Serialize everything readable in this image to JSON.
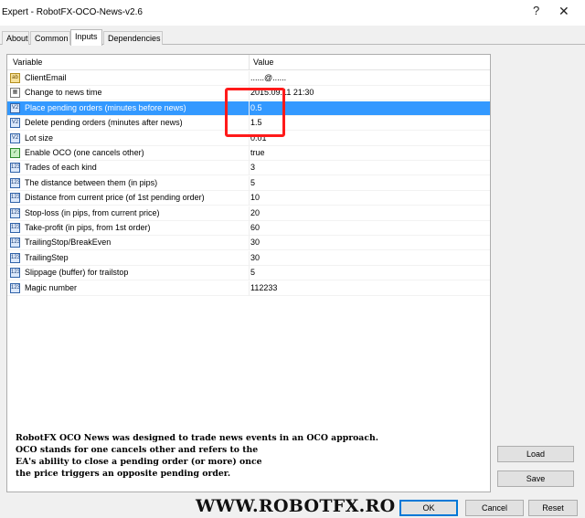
{
  "window": {
    "title": "Expert - RobotFX-OCO-News-v2.6",
    "help_glyph": "?",
    "close_glyph": "✕"
  },
  "tabs": [
    {
      "label": "About",
      "active": false
    },
    {
      "label": "Common",
      "active": false
    },
    {
      "label": "Inputs",
      "active": true
    },
    {
      "label": "Dependencies",
      "active": false
    }
  ],
  "grid": {
    "headers": {
      "variable": "Variable",
      "value": "Value"
    },
    "rows": [
      {
        "icon": "string-icon",
        "glyph": "ab",
        "name": "ClientEmail",
        "value": "......@......",
        "selected": false
      },
      {
        "icon": "datetime-icon",
        "glyph": "▦",
        "name": "Change to news time",
        "value": "2015.09.11 21:30",
        "selected": false
      },
      {
        "icon": "double-icon",
        "glyph": "V2",
        "name": "Place pending orders (minutes before news)",
        "value": "0.5",
        "selected": true
      },
      {
        "icon": "double-icon",
        "glyph": "V2",
        "name": "Delete pending orders (minutes after news)",
        "value": "1.5",
        "selected": false
      },
      {
        "icon": "double-icon",
        "glyph": "V2",
        "name": "Lot size",
        "value": "0.01",
        "selected": false
      },
      {
        "icon": "bool-icon",
        "glyph": "✓",
        "name": "Enable OCO (one cancels other)",
        "value": "true",
        "selected": false
      },
      {
        "icon": "int-icon",
        "glyph": "123",
        "name": "Trades of each kind",
        "value": "3",
        "selected": false
      },
      {
        "icon": "int-icon",
        "glyph": "123",
        "name": "The distance between them (in pips)",
        "value": "5",
        "selected": false
      },
      {
        "icon": "int-icon",
        "glyph": "123",
        "name": "Distance from current price (of 1st pending order)",
        "value": "10",
        "selected": false
      },
      {
        "icon": "int-icon",
        "glyph": "123",
        "name": "Stop-loss (in pips, from current price)",
        "value": "20",
        "selected": false
      },
      {
        "icon": "int-icon",
        "glyph": "123",
        "name": "Take-profit (in pips, from 1st order)",
        "value": "60",
        "selected": false
      },
      {
        "icon": "int-icon",
        "glyph": "123",
        "name": "TrailingStop/BreakEven",
        "value": "30",
        "selected": false
      },
      {
        "icon": "int-icon",
        "glyph": "123",
        "name": "TrailingStep",
        "value": "30",
        "selected": false
      },
      {
        "icon": "int-icon",
        "glyph": "123",
        "name": "Slippage (buffer) for trailstop",
        "value": "5",
        "selected": false
      },
      {
        "icon": "int-icon",
        "glyph": "123",
        "name": "Magic number",
        "value": "112233",
        "selected": false
      }
    ]
  },
  "promo_lines": [
    "RobotFX OCO News was designed to trade news events in an OCO approach.",
    "OCO stands for one cancels other and refers to the",
    "EA's ability to close a pending order (or more) once",
    "the price triggers an opposite pending order."
  ],
  "buttons": {
    "load": "Load",
    "save": "Save",
    "ok": "OK",
    "cancel": "Cancel",
    "reset": "Reset"
  },
  "watermark": "WWW.ROBOTFX.RO",
  "colors": {
    "selection": "#3399ff",
    "highlight_box": "#ff1a1a"
  }
}
